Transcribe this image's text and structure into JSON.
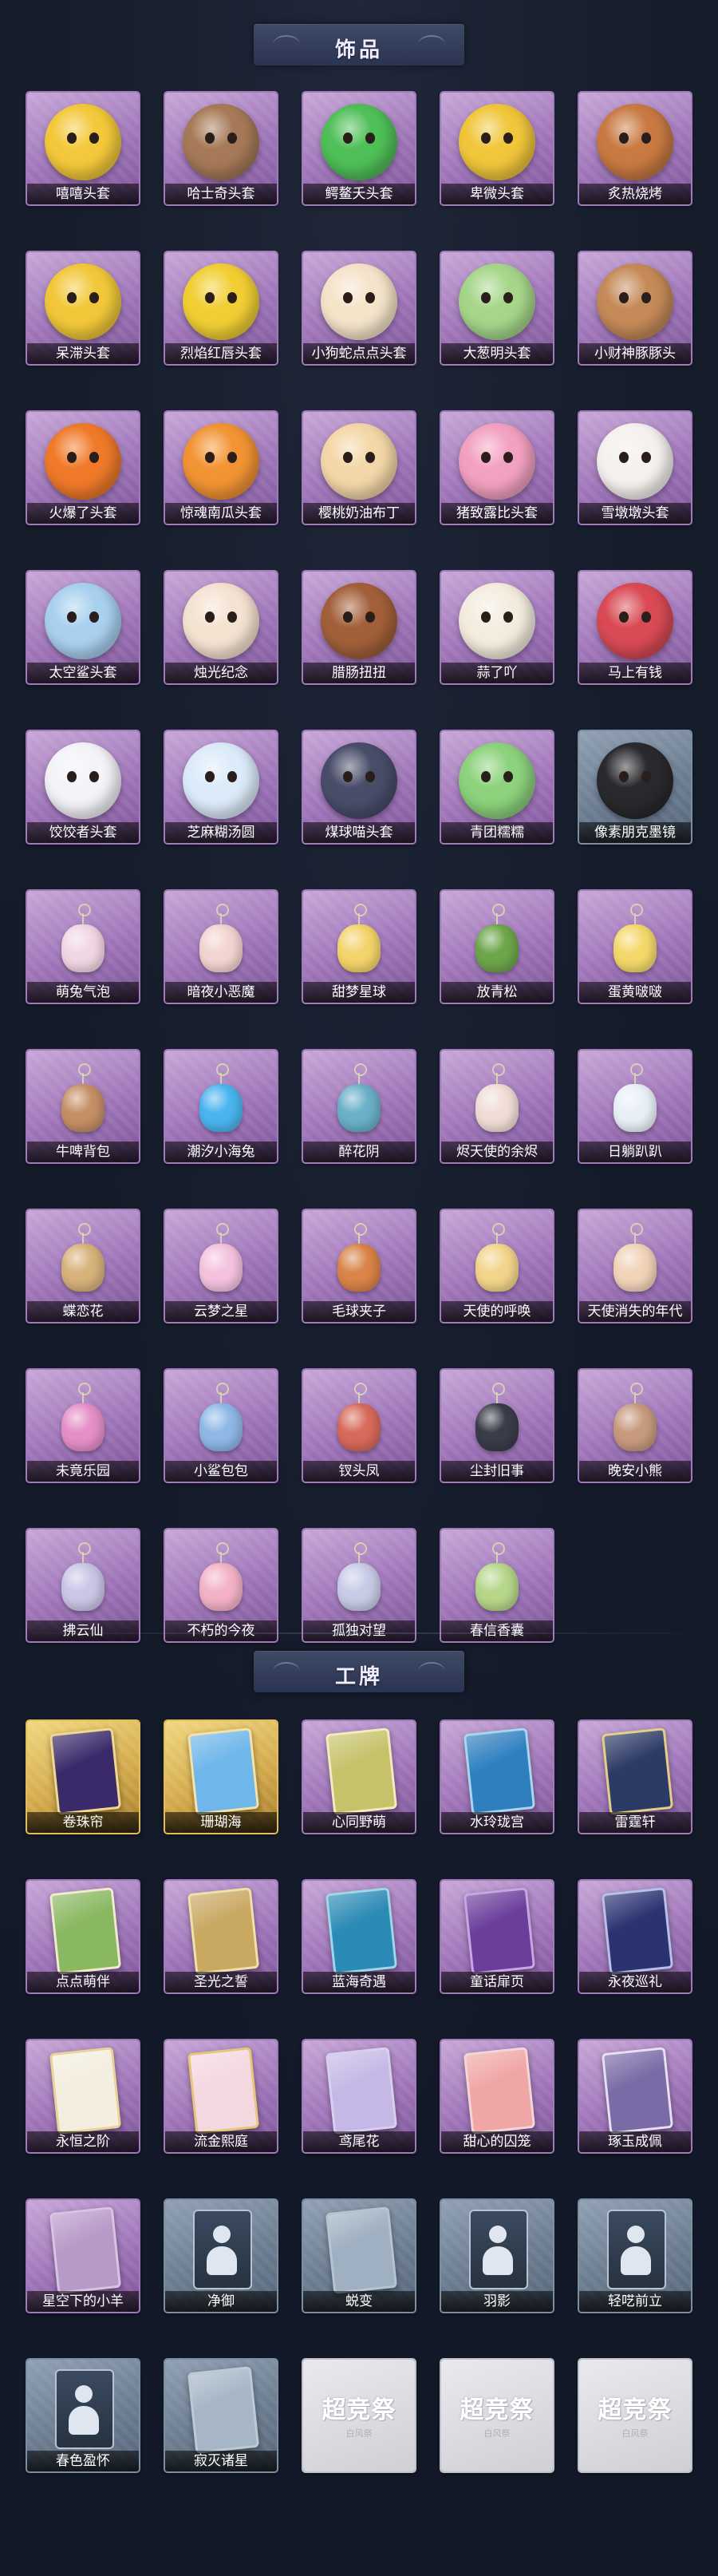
{
  "sections": [
    {
      "title": "饰品",
      "items": [
        {
          "name": "嘻嘻头套",
          "style": "purple",
          "art": "mask",
          "color": "#f3c83a"
        },
        {
          "name": "哈士奇头套",
          "style": "purple",
          "art": "mask",
          "color": "#a67a58"
        },
        {
          "name": "鳄鳌夭头套",
          "style": "purple",
          "art": "mask",
          "color": "#4fbf57"
        },
        {
          "name": "卑微头套",
          "style": "purple",
          "art": "mask",
          "color": "#f1c63b"
        },
        {
          "name": "炙热烧烤",
          "style": "purple",
          "art": "mask",
          "color": "#c87a42"
        },
        {
          "name": "呆滞头套",
          "style": "purple",
          "art": "mask",
          "color": "#f2c83a"
        },
        {
          "name": "烈焰红唇头套",
          "style": "purple",
          "art": "mask",
          "color": "#f1cf34"
        },
        {
          "name": "小狗蛇点点头套",
          "style": "purple",
          "art": "mask",
          "color": "#f4e4c9"
        },
        {
          "name": "大葱明头套",
          "style": "purple",
          "art": "mask",
          "color": "#a6d68a"
        },
        {
          "name": "小财神豚豚头",
          "style": "purple",
          "art": "mask",
          "color": "#c58a58"
        },
        {
          "name": "火爆了头套",
          "style": "purple",
          "art": "mask",
          "color": "#f07a2a"
        },
        {
          "name": "惊魂南瓜头套",
          "style": "purple",
          "art": "mask",
          "color": "#f29434"
        },
        {
          "name": "樱桃奶油布丁",
          "style": "purple",
          "art": "mask",
          "color": "#f4d7a8"
        },
        {
          "name": "猪致露比头套",
          "style": "purple",
          "art": "mask",
          "color": "#f3a1c0"
        },
        {
          "name": "雪墩墩头套",
          "style": "purple",
          "art": "mask",
          "color": "#f4f1ee"
        },
        {
          "name": "太空鲨头套",
          "style": "purple",
          "art": "mask",
          "color": "#a9d1ef"
        },
        {
          "name": "烛光纪念",
          "style": "purple",
          "art": "mask",
          "color": "#f5e3d2"
        },
        {
          "name": "腊肠扭扭",
          "style": "purple",
          "art": "mask",
          "color": "#a2603a"
        },
        {
          "name": "蒜了吖",
          "style": "purple",
          "art": "mask",
          "color": "#f4eddf"
        },
        {
          "name": "马上有钱",
          "style": "purple",
          "art": "mask",
          "color": "#d94a55"
        },
        {
          "name": "饺饺者头套",
          "style": "purple",
          "art": "mask",
          "color": "#f4f3f8"
        },
        {
          "name": "芝麻糊汤圆",
          "style": "purple",
          "art": "mask",
          "color": "#dcebfa"
        },
        {
          "name": "煤球喵头套",
          "style": "purple",
          "art": "mask",
          "color": "#4a4d6a"
        },
        {
          "name": "青团糯糯",
          "style": "purple",
          "art": "mask",
          "color": "#8dd27c"
        },
        {
          "name": "像素朋克墨镜",
          "style": "grey",
          "art": "mask",
          "color": "#2a2a2e"
        },
        {
          "name": "萌兔气泡",
          "style": "purple",
          "art": "charm",
          "color": "#f1d6e3"
        },
        {
          "name": "暗夜小恶魔",
          "style": "purple",
          "art": "charm",
          "color": "#f2d4d0"
        },
        {
          "name": "甜梦星球",
          "style": "purple",
          "art": "charm",
          "color": "#f3d36a"
        },
        {
          "name": "放青松",
          "style": "purple",
          "art": "charm",
          "color": "#6da64a"
        },
        {
          "name": "蛋黄啵啵",
          "style": "purple",
          "art": "charm",
          "color": "#f4d86a"
        },
        {
          "name": "牛啤背包",
          "style": "purple",
          "art": "charm",
          "color": "#c58f66"
        },
        {
          "name": "潮汐小海兔",
          "style": "purple",
          "art": "charm",
          "color": "#4ab4ee"
        },
        {
          "name": "醉花阴",
          "style": "purple",
          "art": "charm",
          "color": "#6ab0c8"
        },
        {
          "name": "烬天使的余烬",
          "style": "purple",
          "art": "charm",
          "color": "#f1ddd6"
        },
        {
          "name": "日躺趴趴",
          "style": "purple",
          "art": "charm",
          "color": "#e8f0f7"
        },
        {
          "name": "蝶恋花",
          "style": "purple",
          "art": "charm",
          "color": "#d7b27a"
        },
        {
          "name": "云梦之星",
          "style": "purple",
          "art": "charm",
          "color": "#f4c2de"
        },
        {
          "name": "毛球夹子",
          "style": "purple",
          "art": "charm",
          "color": "#d98448"
        },
        {
          "name": "天使的呼唤",
          "style": "purple",
          "art": "charm",
          "color": "#f2d48a"
        },
        {
          "name": "天使消失的年代",
          "style": "purple",
          "art": "charm",
          "color": "#f1d3b8"
        },
        {
          "name": "未竟乐园",
          "style": "purple",
          "art": "charm",
          "color": "#e58fc8"
        },
        {
          "name": "小鲨包包",
          "style": "purple",
          "art": "charm",
          "color": "#8fb8e6"
        },
        {
          "name": "钗头凤",
          "style": "purple",
          "art": "charm",
          "color": "#d76a5a"
        },
        {
          "name": "尘封旧事",
          "style": "purple",
          "art": "charm",
          "color": "#3a3c4a"
        },
        {
          "name": "晚安小熊",
          "style": "purple",
          "art": "charm",
          "color": "#c79a7e"
        },
        {
          "name": "拂云仙",
          "style": "purple",
          "art": "charm",
          "color": "#c9c6e6"
        },
        {
          "name": "不朽的今夜",
          "style": "purple",
          "art": "charm",
          "color": "#f3b2c6"
        },
        {
          "name": "孤独对望",
          "style": "purple",
          "art": "charm",
          "color": "#c8cbe6"
        },
        {
          "name": "春信香囊",
          "style": "purple",
          "art": "charm",
          "color": "#b6d68a"
        }
      ]
    },
    {
      "title": "工牌",
      "items": [
        {
          "name": "卷珠帘",
          "style": "gold",
          "art": "frame",
          "color": "#3a2a6a",
          "border": "#f1d890"
        },
        {
          "name": "珊瑚海",
          "style": "gold",
          "art": "frame",
          "color": "#6fb6ea",
          "border": "#f4e2a8"
        },
        {
          "name": "心同野萌",
          "style": "purple",
          "art": "frame",
          "color": "#c6c26a",
          "border": "#f4eac0"
        },
        {
          "name": "水玲珑宫",
          "style": "purple",
          "art": "frame",
          "color": "#2f7fbf",
          "border": "#a8d6f1"
        },
        {
          "name": "雷霆轩",
          "style": "purple",
          "art": "frame",
          "color": "#2c3a66",
          "border": "#e4cf8a"
        },
        {
          "name": "点点萌伴",
          "style": "purple",
          "art": "frame",
          "color": "#8ab860",
          "border": "#f0ead0"
        },
        {
          "name": "圣光之誓",
          "style": "purple",
          "art": "frame",
          "color": "#c9a862",
          "border": "#f1e0a8"
        },
        {
          "name": "蓝海奇遇",
          "style": "purple",
          "art": "frame",
          "color": "#2b8ab6",
          "border": "#9fd6ea"
        },
        {
          "name": "童话扉页",
          "style": "purple",
          "art": "frame",
          "color": "#6a3e9a",
          "border": "#c8a6e6"
        },
        {
          "name": "永夜巡礼",
          "style": "purple",
          "art": "frame",
          "color": "#2a3270",
          "border": "#b6c0ea"
        },
        {
          "name": "永恒之阶",
          "style": "purple",
          "art": "frame",
          "color": "#f3eedf",
          "border": "#e8d39a"
        },
        {
          "name": "流金熙庭",
          "style": "purple",
          "art": "frame",
          "color": "#f4d8e0",
          "border": "#e6c67a"
        },
        {
          "name": "鸢尾花",
          "style": "purple",
          "art": "frame",
          "color": "#c6b8e6",
          "border": "#d8cff0"
        },
        {
          "name": "甜心的囚笼",
          "style": "purple",
          "art": "frame",
          "color": "#f0a6a6",
          "border": "#f4d6d6"
        },
        {
          "name": "琢玉成佩",
          "style": "purple",
          "art": "frame",
          "color": "#7a6aa6",
          "border": "#e6e0f4"
        },
        {
          "name": "星空下的小羊",
          "style": "purple",
          "art": "frame",
          "color": "#b89ac8",
          "border": "#d6c4e2"
        },
        {
          "name": "净御",
          "style": "grey",
          "art": "silhouette",
          "color": "#3a4a60"
        },
        {
          "name": "蜕变",
          "style": "grey",
          "art": "frame",
          "color": "#9fb0c2",
          "border": "#b6c4d2"
        },
        {
          "name": "羽影",
          "style": "grey",
          "art": "silhouette",
          "color": "#3a4a60"
        },
        {
          "name": "轻呓前立",
          "style": "grey",
          "art": "silhouette",
          "color": "#3a4a60"
        },
        {
          "name": "春色盈怀",
          "style": "grey",
          "art": "silhouette",
          "color": "#3a4a60"
        },
        {
          "name": "寂灭诸星",
          "style": "grey",
          "art": "frame",
          "color": "#a6b6c6",
          "border": "#bccad6"
        },
        {
          "name": "",
          "style": "white",
          "art": "placeholder",
          "logo": "超竞祭",
          "sub": "白风祭"
        },
        {
          "name": "",
          "style": "white",
          "art": "placeholder",
          "logo": "超竞祭",
          "sub": "白风祭"
        },
        {
          "name": "",
          "style": "white",
          "art": "placeholder",
          "logo": "超竞祭",
          "sub": "白风祭"
        }
      ]
    }
  ]
}
